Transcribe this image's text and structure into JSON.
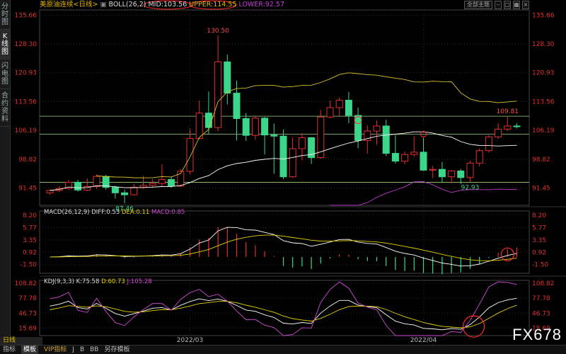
{
  "sidebar": {
    "tabs": [
      "分时图",
      "K线图",
      "闪电图",
      "合约资料"
    ]
  },
  "toolbar": {
    "layout_button": "全部主题",
    "period_badge": "日线"
  },
  "header": {
    "instrument": "美原油连续<日线>",
    "boll_label": "BOLL(26,2)",
    "mid": "MID:103.56",
    "upper": "UPPER:114.55",
    "lower": "LOWER:92.57"
  },
  "macd_header": {
    "label": "MACD(26,12,9)",
    "diff": "DIFF:0.53",
    "dea": "DEA:0.11",
    "macd": "MACD:0.85"
  },
  "kdj_header": {
    "label": "KDJ(9,3,3)",
    "k": "K:75.58",
    "d": "D:60.73",
    "j": "J:105.28"
  },
  "bottom_tabs": [
    "指标",
    "模板",
    "VIP指标",
    "J",
    "B",
    "BB",
    "另存模板"
  ],
  "watermark": "FX678",
  "colors": {
    "up": "#e22e2e",
    "down": "#3cd68a",
    "mid": "#ffffff",
    "band": "#d8c52a",
    "lower": "#c23bd4"
  },
  "chart_data": [
    {
      "type": "candlestick",
      "ylim": [
        87.0,
        137.0
      ],
      "y_ticks": [
        "135.66",
        "128.30",
        "120.93",
        "113.56",
        "106.19",
        "98.82",
        "91.45"
      ],
      "x_labels": [
        {
          "label": "2022/03",
          "i": 15
        },
        {
          "label": "2022/04",
          "i": 40
        }
      ],
      "annotations": [
        {
          "text": "130.50",
          "i": 18,
          "value": 130.5,
          "pos": "high"
        },
        {
          "text": "87.46",
          "i": 8,
          "value": 87.46,
          "pos": "low"
        },
        {
          "text": "92.93",
          "i": 45,
          "value": 92.93,
          "pos": "low"
        },
        {
          "text": "109.81",
          "i": 49,
          "value": 109.81,
          "pos": "high"
        }
      ],
      "hlines": [
        92.9,
        109.8,
        105.2
      ],
      "candles": [
        [
          90.2,
          90.8,
          89.7,
          91.0
        ],
        [
          90.8,
          91.3,
          90.4,
          91.9
        ],
        [
          91.3,
          92.9,
          91.0,
          93.5
        ],
        [
          92.9,
          90.9,
          90.5,
          93.5
        ],
        [
          90.9,
          91.8,
          90.6,
          93.9
        ],
        [
          91.8,
          94.4,
          91.2,
          94.9
        ],
        [
          94.4,
          91.6,
          91.0,
          94.8
        ],
        [
          91.6,
          90.2,
          88.7,
          92.0
        ],
        [
          90.2,
          89.7,
          87.5,
          91.0
        ],
        [
          89.7,
          91.6,
          89.5,
          92.5
        ],
        [
          91.6,
          92.1,
          91.2,
          94.5
        ],
        [
          92.1,
          92.6,
          91.5,
          93.8
        ],
        [
          92.6,
          93.6,
          91.8,
          97.5
        ],
        [
          93.6,
          91.9,
          91.5,
          94.3
        ],
        [
          91.9,
          95.7,
          91.7,
          96.3
        ],
        [
          95.7,
          104.1,
          95.0,
          106.7
        ],
        [
          104.1,
          110.6,
          103.9,
          113.8
        ],
        [
          110.6,
          106.9,
          105.2,
          116.1
        ],
        [
          106.9,
          123.7,
          106.0,
          130.5
        ],
        [
          123.7,
          115.7,
          112.8,
          125.6
        ],
        [
          115.7,
          109.2,
          103.6,
          118.9
        ],
        [
          109.2,
          104.9,
          103.5,
          110.6
        ],
        [
          104.9,
          109.3,
          103.8,
          109.8
        ],
        [
          109.3,
          105.0,
          100.0,
          109.6
        ],
        [
          105.0,
          104.7,
          95.1,
          107.9
        ],
        [
          104.7,
          94.3,
          93.7,
          106.4
        ],
        [
          94.3,
          101.5,
          94.0,
          104.4
        ],
        [
          101.5,
          104.3,
          98.5,
          105.5
        ],
        [
          104.3,
          99.2,
          97.6,
          104.5
        ],
        [
          99.2,
          109.6,
          98.9,
          111.4
        ],
        [
          109.6,
          112.0,
          109.3,
          113.8
        ],
        [
          112.0,
          113.9,
          109.8,
          114.6
        ],
        [
          113.9,
          110.0,
          108.0,
          116.0
        ],
        [
          110.0,
          103.6,
          101.6,
          112.0
        ],
        [
          103.6,
          106.0,
          100.2,
          107.5
        ],
        [
          106.0,
          107.3,
          102.5,
          108.7
        ],
        [
          107.3,
          100.3,
          99.6,
          108.9
        ],
        [
          100.3,
          98.3,
          97.7,
          105.0
        ],
        [
          98.3,
          100.0,
          97.5,
          100.8
        ],
        [
          100.0,
          100.6,
          99.5,
          104.6
        ],
        [
          100.6,
          96.0,
          95.8,
          104.2
        ],
        [
          96.0,
          96.2,
          94.0,
          97.1
        ],
        [
          96.2,
          94.3,
          93.0,
          98.1
        ],
        [
          94.3,
          95.8,
          92.6,
          96.0
        ],
        [
          95.8,
          94.1,
          92.5,
          96.3
        ],
        [
          94.1,
          97.8,
          92.9,
          98.4
        ],
        [
          97.8,
          101.0,
          97.0,
          101.5
        ],
        [
          101.0,
          104.5,
          100.5,
          105.0
        ],
        [
          104.5,
          106.5,
          104.0,
          108.0
        ],
        [
          106.5,
          107.3,
          106.0,
          109.8
        ],
        [
          107.3,
          107.1,
          106.7,
          108.0
        ]
      ]
    },
    {
      "type": "line",
      "name": "MACD",
      "ylim": [
        -3.2,
        9.0
      ],
      "y_ticks": [
        "8.20",
        "5.77",
        "3.35",
        "0.92",
        "-1.50"
      ],
      "series_hint": "DIFF, DEA, MACD histogram"
    },
    {
      "type": "line",
      "name": "KDJ",
      "ylim": [
        0.0,
        115.0
      ],
      "y_ticks": [
        "108.82",
        "77.78",
        "46.73",
        "15.69"
      ]
    }
  ]
}
